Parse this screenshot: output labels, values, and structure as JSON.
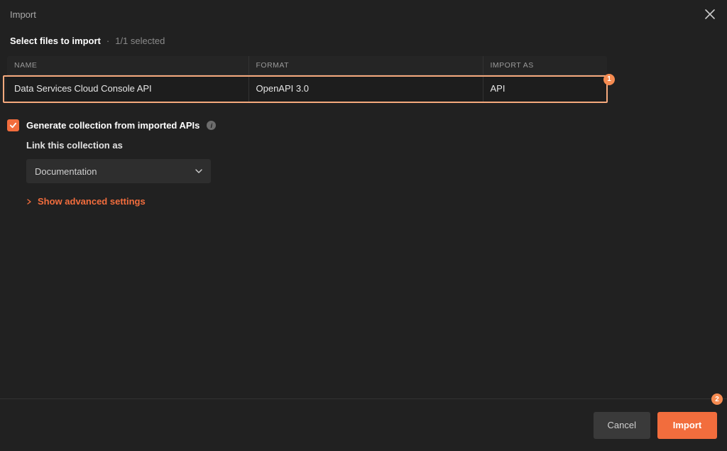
{
  "dialog": {
    "title": "Import",
    "subtitle": "Select files to import",
    "selection_count": "1/1 selected"
  },
  "table": {
    "headers": {
      "name": "NAME",
      "format": "FORMAT",
      "import_as": "IMPORT AS"
    },
    "rows": [
      {
        "name": "Data Services Cloud Console API",
        "format": "OpenAPI 3.0",
        "import_as": "API"
      }
    ]
  },
  "annotations": {
    "row_badge": "1",
    "import_badge": "2"
  },
  "options": {
    "generate_label": "Generate collection from imported APIs",
    "link_label": "Link this collection as",
    "dropdown_value": "Documentation",
    "advanced_label": "Show advanced settings"
  },
  "footer": {
    "cancel": "Cancel",
    "import": "Import"
  },
  "icons": {
    "close": "close",
    "info": "i",
    "chevron_down": "chevron-down",
    "chevron_right": "chevron-right",
    "check": "check"
  }
}
